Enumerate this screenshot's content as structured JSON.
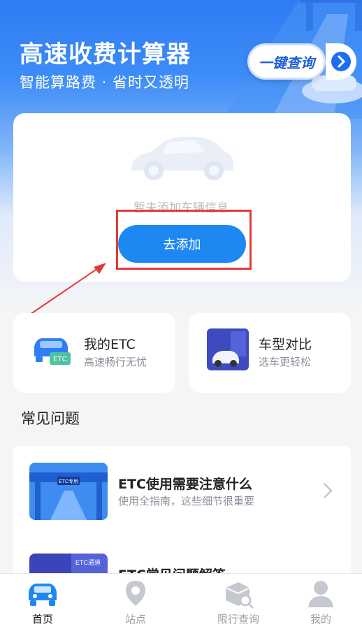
{
  "header": {
    "title": "高速收费计算器",
    "subtitle": "智能算路费 · 省时又透明",
    "query_badge": "一键查询"
  },
  "vehicle_card": {
    "empty_text": "暂未添加车辆信息",
    "add_button": "去添加"
  },
  "features": [
    {
      "title": "我的ETC",
      "subtitle": "高速畅行无忧",
      "icon": "etc-car-icon"
    },
    {
      "title": "车型对比",
      "subtitle": "选车更轻松",
      "icon": "car-compare-icon"
    }
  ],
  "faq": {
    "section_title": "常见问题",
    "items": [
      {
        "title": "ETC使用需要注意什么",
        "subtitle": "使用全指南，这些细节很重要",
        "thumb_label": "ETC专用"
      },
      {
        "title": "ETC常见问题解答",
        "subtitle": "",
        "thumb_label": "ETC通道"
      }
    ]
  },
  "tabbar": {
    "tabs": [
      {
        "label": "首页",
        "icon": "car-icon",
        "active": true
      },
      {
        "label": "站点",
        "icon": "location-pin-icon",
        "active": false
      },
      {
        "label": "限行查询",
        "icon": "box-search-icon",
        "active": false
      },
      {
        "label": "我的",
        "icon": "user-icon",
        "active": false
      }
    ]
  },
  "colors": {
    "primary": "#1e88f2",
    "hero_blue": "#2f7cf3",
    "annotation_red": "#e53935"
  }
}
